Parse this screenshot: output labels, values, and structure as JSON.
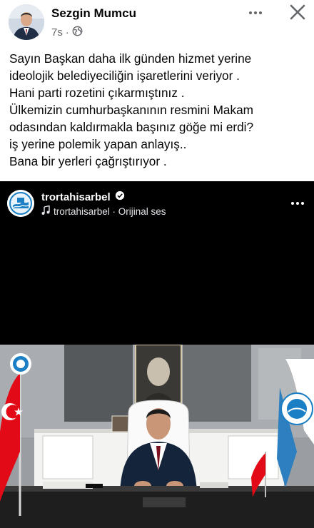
{
  "post": {
    "author": "Sezgin Mumcu",
    "time": "7s",
    "separator": "·",
    "privacy_icon": "globe-icon",
    "lines": [
      "Sayın Başkan daha ilk günden hizmet yerine",
      "ideolojik belediyeciliğin işaretlerini veriyor .",
      "Hani parti rozetini çıkarmıştınız .",
      "Ülkemizin cumhurbaşkanının resmini Makam",
      "odasından kaldırmakla başınız göğe mi erdi?",
      "iş yerine polemik yapan anlayış..",
      "Bana bir yerleri çağrıştırıyor ."
    ]
  },
  "reel": {
    "username": "trortahisarbel",
    "audio": "trortahisarbel · Orijinal ses",
    "verified_icon": "verified-badge-icon",
    "music_icon": "music-note-icon"
  },
  "colors": {
    "text": "#050505",
    "secondary": "#65676b",
    "reel_bg": "#000000",
    "flag_red": "#e30a17"
  }
}
